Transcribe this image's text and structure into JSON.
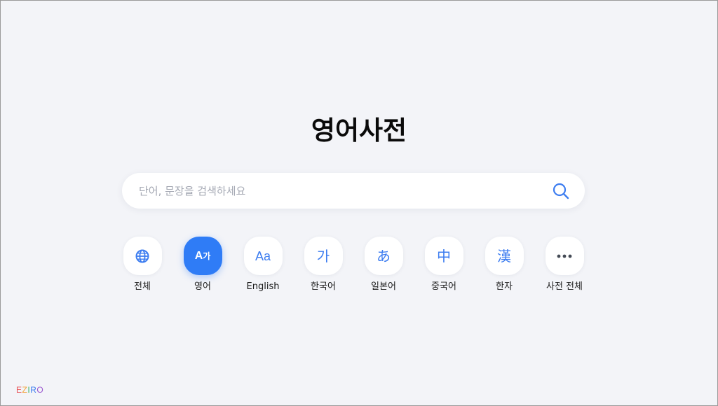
{
  "page": {
    "title": "영어사전"
  },
  "search": {
    "placeholder": "단어, 문장을 검색하세요",
    "value": ""
  },
  "categories": [
    {
      "label": "전체",
      "icon": "globe-icon",
      "glyph": ""
    },
    {
      "label": "영어",
      "icon": "translate-icon",
      "glyph": "A가",
      "active": true
    },
    {
      "label": "English",
      "icon": "english-icon",
      "glyph": "Aa"
    },
    {
      "label": "한국어",
      "icon": "korean-icon",
      "glyph": "가"
    },
    {
      "label": "일본어",
      "icon": "japanese-icon",
      "glyph": "あ"
    },
    {
      "label": "중국어",
      "icon": "chinese-icon",
      "glyph": "中"
    },
    {
      "label": "한자",
      "icon": "hanja-icon",
      "glyph": "漢"
    },
    {
      "label": "사전 전체",
      "icon": "more-icon",
      "glyph": ""
    }
  ],
  "brand": {
    "letters": [
      "E",
      "Z",
      "I",
      "R",
      "O"
    ],
    "colors": [
      "#e8565a",
      "#f2a33a",
      "#3fb36a",
      "#3d7df0",
      "#9b59d0"
    ]
  },
  "colors": {
    "accent": "#2f7cf6",
    "icon": "#3d7df0",
    "background": "#f3f4f8"
  }
}
